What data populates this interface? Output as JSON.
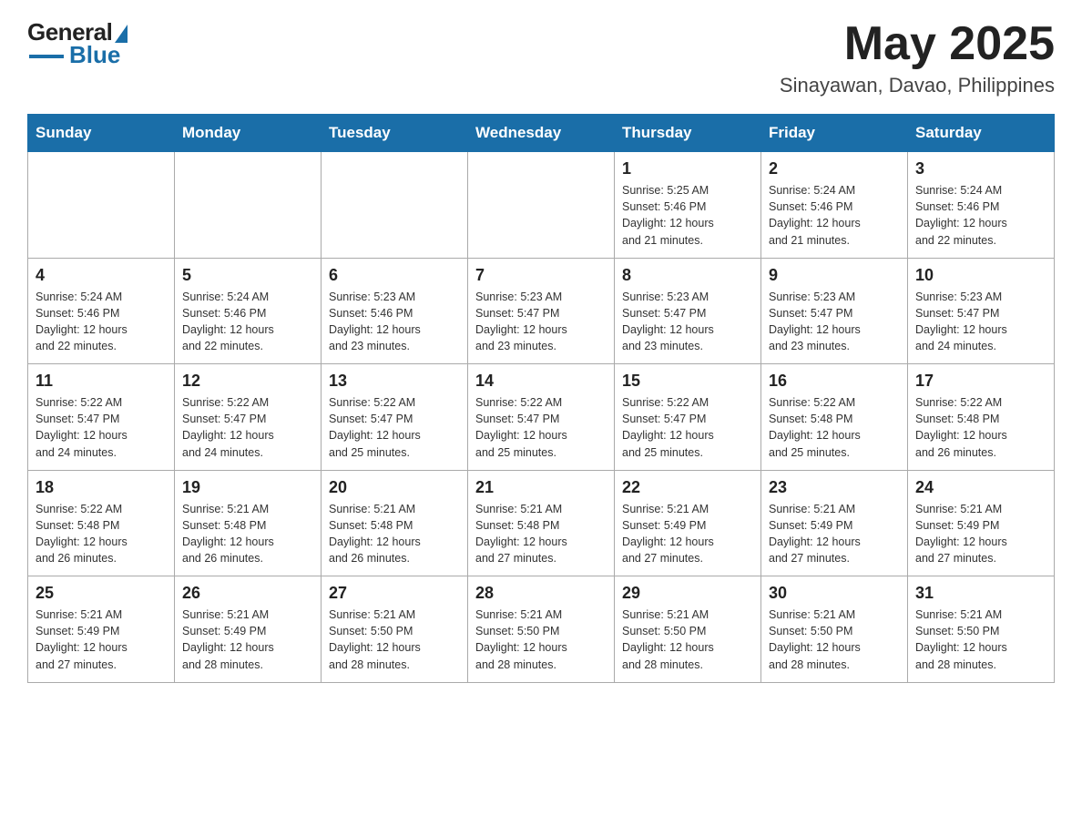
{
  "header": {
    "logo_general": "General",
    "logo_blue": "Blue",
    "title": "May 2025",
    "subtitle": "Sinayawan, Davao, Philippines"
  },
  "days_of_week": [
    "Sunday",
    "Monday",
    "Tuesday",
    "Wednesday",
    "Thursday",
    "Friday",
    "Saturday"
  ],
  "weeks": [
    [
      {
        "num": "",
        "info": ""
      },
      {
        "num": "",
        "info": ""
      },
      {
        "num": "",
        "info": ""
      },
      {
        "num": "",
        "info": ""
      },
      {
        "num": "1",
        "info": "Sunrise: 5:25 AM\nSunset: 5:46 PM\nDaylight: 12 hours\nand 21 minutes."
      },
      {
        "num": "2",
        "info": "Sunrise: 5:24 AM\nSunset: 5:46 PM\nDaylight: 12 hours\nand 21 minutes."
      },
      {
        "num": "3",
        "info": "Sunrise: 5:24 AM\nSunset: 5:46 PM\nDaylight: 12 hours\nand 22 minutes."
      }
    ],
    [
      {
        "num": "4",
        "info": "Sunrise: 5:24 AM\nSunset: 5:46 PM\nDaylight: 12 hours\nand 22 minutes."
      },
      {
        "num": "5",
        "info": "Sunrise: 5:24 AM\nSunset: 5:46 PM\nDaylight: 12 hours\nand 22 minutes."
      },
      {
        "num": "6",
        "info": "Sunrise: 5:23 AM\nSunset: 5:46 PM\nDaylight: 12 hours\nand 23 minutes."
      },
      {
        "num": "7",
        "info": "Sunrise: 5:23 AM\nSunset: 5:47 PM\nDaylight: 12 hours\nand 23 minutes."
      },
      {
        "num": "8",
        "info": "Sunrise: 5:23 AM\nSunset: 5:47 PM\nDaylight: 12 hours\nand 23 minutes."
      },
      {
        "num": "9",
        "info": "Sunrise: 5:23 AM\nSunset: 5:47 PM\nDaylight: 12 hours\nand 23 minutes."
      },
      {
        "num": "10",
        "info": "Sunrise: 5:23 AM\nSunset: 5:47 PM\nDaylight: 12 hours\nand 24 minutes."
      }
    ],
    [
      {
        "num": "11",
        "info": "Sunrise: 5:22 AM\nSunset: 5:47 PM\nDaylight: 12 hours\nand 24 minutes."
      },
      {
        "num": "12",
        "info": "Sunrise: 5:22 AM\nSunset: 5:47 PM\nDaylight: 12 hours\nand 24 minutes."
      },
      {
        "num": "13",
        "info": "Sunrise: 5:22 AM\nSunset: 5:47 PM\nDaylight: 12 hours\nand 25 minutes."
      },
      {
        "num": "14",
        "info": "Sunrise: 5:22 AM\nSunset: 5:47 PM\nDaylight: 12 hours\nand 25 minutes."
      },
      {
        "num": "15",
        "info": "Sunrise: 5:22 AM\nSunset: 5:47 PM\nDaylight: 12 hours\nand 25 minutes."
      },
      {
        "num": "16",
        "info": "Sunrise: 5:22 AM\nSunset: 5:48 PM\nDaylight: 12 hours\nand 25 minutes."
      },
      {
        "num": "17",
        "info": "Sunrise: 5:22 AM\nSunset: 5:48 PM\nDaylight: 12 hours\nand 26 minutes."
      }
    ],
    [
      {
        "num": "18",
        "info": "Sunrise: 5:22 AM\nSunset: 5:48 PM\nDaylight: 12 hours\nand 26 minutes."
      },
      {
        "num": "19",
        "info": "Sunrise: 5:21 AM\nSunset: 5:48 PM\nDaylight: 12 hours\nand 26 minutes."
      },
      {
        "num": "20",
        "info": "Sunrise: 5:21 AM\nSunset: 5:48 PM\nDaylight: 12 hours\nand 26 minutes."
      },
      {
        "num": "21",
        "info": "Sunrise: 5:21 AM\nSunset: 5:48 PM\nDaylight: 12 hours\nand 27 minutes."
      },
      {
        "num": "22",
        "info": "Sunrise: 5:21 AM\nSunset: 5:49 PM\nDaylight: 12 hours\nand 27 minutes."
      },
      {
        "num": "23",
        "info": "Sunrise: 5:21 AM\nSunset: 5:49 PM\nDaylight: 12 hours\nand 27 minutes."
      },
      {
        "num": "24",
        "info": "Sunrise: 5:21 AM\nSunset: 5:49 PM\nDaylight: 12 hours\nand 27 minutes."
      }
    ],
    [
      {
        "num": "25",
        "info": "Sunrise: 5:21 AM\nSunset: 5:49 PM\nDaylight: 12 hours\nand 27 minutes."
      },
      {
        "num": "26",
        "info": "Sunrise: 5:21 AM\nSunset: 5:49 PM\nDaylight: 12 hours\nand 28 minutes."
      },
      {
        "num": "27",
        "info": "Sunrise: 5:21 AM\nSunset: 5:50 PM\nDaylight: 12 hours\nand 28 minutes."
      },
      {
        "num": "28",
        "info": "Sunrise: 5:21 AM\nSunset: 5:50 PM\nDaylight: 12 hours\nand 28 minutes."
      },
      {
        "num": "29",
        "info": "Sunrise: 5:21 AM\nSunset: 5:50 PM\nDaylight: 12 hours\nand 28 minutes."
      },
      {
        "num": "30",
        "info": "Sunrise: 5:21 AM\nSunset: 5:50 PM\nDaylight: 12 hours\nand 28 minutes."
      },
      {
        "num": "31",
        "info": "Sunrise: 5:21 AM\nSunset: 5:50 PM\nDaylight: 12 hours\nand 28 minutes."
      }
    ]
  ]
}
